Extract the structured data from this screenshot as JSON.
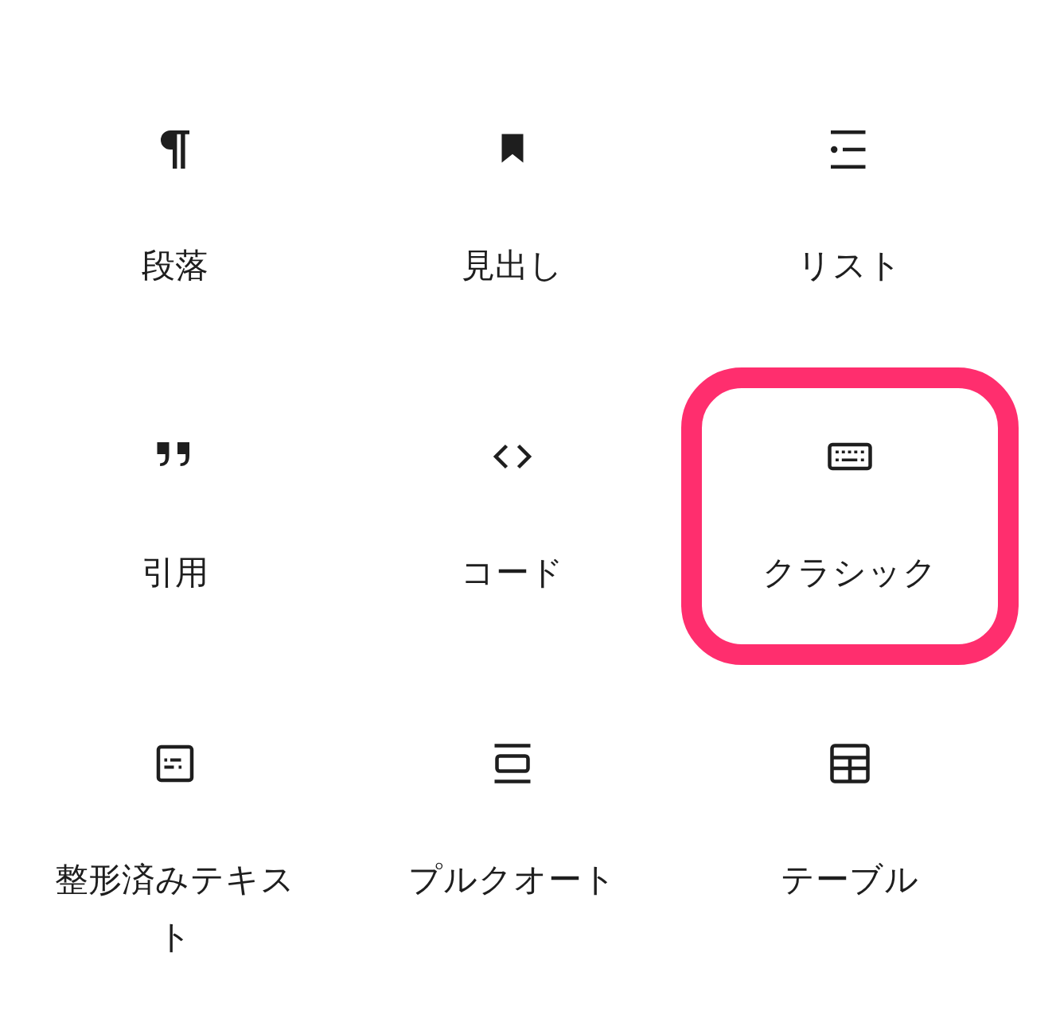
{
  "blocks": [
    {
      "kind": "paragraph",
      "label": "段落",
      "highlighted": false
    },
    {
      "kind": "heading",
      "label": "見出し",
      "highlighted": false
    },
    {
      "kind": "list",
      "label": "リスト",
      "highlighted": false
    },
    {
      "kind": "quote",
      "label": "引用",
      "highlighted": false
    },
    {
      "kind": "code",
      "label": "コード",
      "highlighted": false
    },
    {
      "kind": "classic",
      "label": "クラシック",
      "highlighted": true
    },
    {
      "kind": "preformatted",
      "label": "整形済みテキスト",
      "highlighted": false
    },
    {
      "kind": "pullquote",
      "label": "プルクオート",
      "highlighted": false
    },
    {
      "kind": "table",
      "label": "テーブル",
      "highlighted": false
    }
  ]
}
